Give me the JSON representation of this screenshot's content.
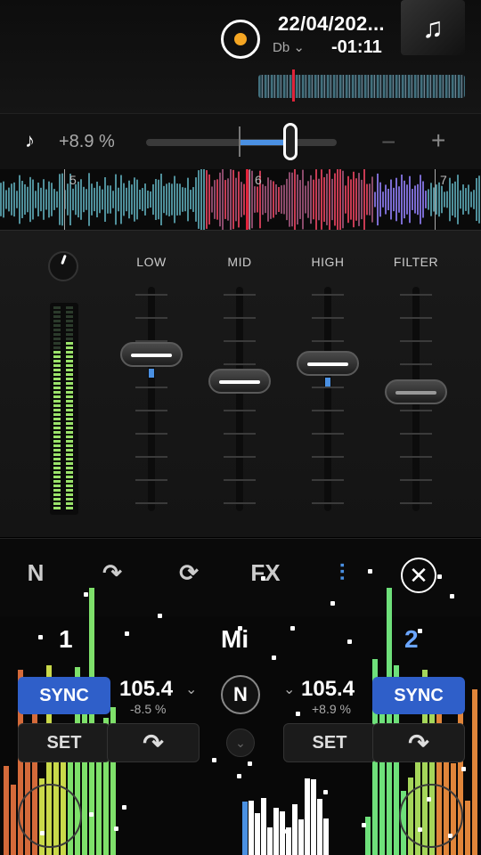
{
  "track": {
    "date": "22/04/202...",
    "key": "Db",
    "time_remaining": "-01:11",
    "artwork_icon": "music-note-icon"
  },
  "pitch": {
    "value": "+8.9 %",
    "minus": "−",
    "plus": "+",
    "slider_fraction": 0.66
  },
  "waveform": {
    "beat_markers": [
      "5",
      "6",
      "7"
    ]
  },
  "eq": {
    "bands": [
      {
        "label": "LOW",
        "level": 0.3
      },
      {
        "label": "MID",
        "level": 0.42
      },
      {
        "label": "HIGH",
        "level": 0.34
      },
      {
        "label": "FILTER",
        "level": 0.47
      }
    ]
  },
  "toolbar": {
    "icons": [
      "N",
      "↷",
      "⟳",
      "FX",
      "⫶"
    ],
    "close": "✕"
  },
  "decks": {
    "left": {
      "number": "1",
      "sync": "SYNC",
      "bpm": "105.4",
      "offset": "-8.5 %",
      "set": "SET"
    },
    "right": {
      "number": "2",
      "sync": "SYNC",
      "bpm": "105.4",
      "offset": "+8.9 %",
      "set": "SET"
    },
    "key": "Mi",
    "master": "N"
  },
  "colors": {
    "accent_blue": "#4a90e2",
    "sync_blue": "#2f5fc9",
    "playhead_red": "#e0233a",
    "record_orange": "#f5a623",
    "meter_green": "#9be36a"
  }
}
